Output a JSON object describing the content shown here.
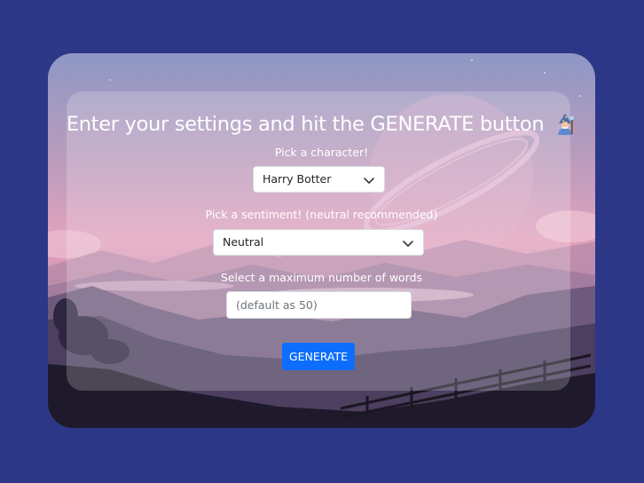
{
  "form": {
    "title": "Enter your settings and hit the GENERATE button",
    "character_label": "Pick a character!",
    "character_value": "Harry Botter",
    "sentiment_label": "Pick a sentiment! (neutral recommended)",
    "sentiment_value": "Neutral",
    "words_label": "Select a maximum number of words",
    "words_placeholder": "(default as 50)",
    "generate_label": "GENERATE"
  },
  "colors": {
    "page_background": "#2c3787",
    "button": "#0d6efd",
    "text": "#ffffff"
  },
  "icons": {
    "title_icon": "wizard-emoji-icon",
    "dropdown_icon": "chevron-down-icon"
  }
}
